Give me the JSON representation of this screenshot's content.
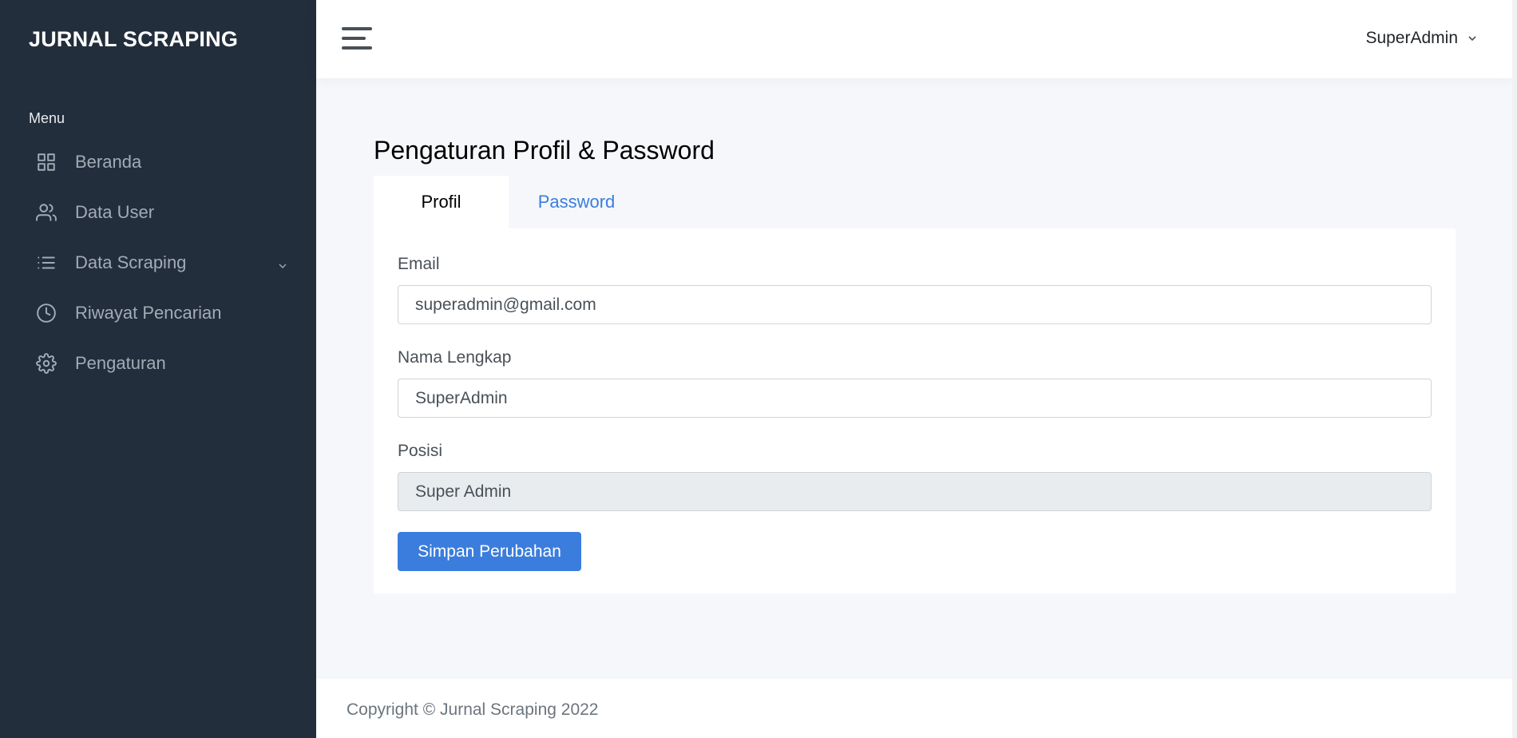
{
  "sidebar": {
    "brand": "JURNAL SCRAPING",
    "menu_header": "Menu",
    "items": [
      {
        "label": "Beranda",
        "icon": "grid-icon"
      },
      {
        "label": "Data User",
        "icon": "users-icon"
      },
      {
        "label": "Data Scraping",
        "icon": "list-icon",
        "has_submenu": true
      },
      {
        "label": "Riwayat Pencarian",
        "icon": "clock-icon"
      },
      {
        "label": "Pengaturan",
        "icon": "settings-icon"
      }
    ]
  },
  "topbar": {
    "user_name": "SuperAdmin",
    "toggle_icon": "hamburger-icon",
    "user_chevron_icon": "chevron-down-icon"
  },
  "main": {
    "title": "Pengaturan Profil & Password",
    "tabs": [
      {
        "label": "Profil",
        "active": true
      },
      {
        "label": "Password",
        "active": false
      }
    ],
    "form": {
      "email_label": "Email",
      "email_value": "superadmin@gmail.com",
      "name_label": "Nama Lengkap",
      "name_value": "SuperAdmin",
      "position_label": "Posisi",
      "position_value": "Super Admin",
      "save_label": "Simpan Perubahan"
    }
  },
  "footer": {
    "copyright": "Copyright © Jurnal Scraping 2022"
  },
  "colors": {
    "sidebar_bg": "#222e3c",
    "accent": "#3b7ddd",
    "page_bg": "#f5f7fb"
  }
}
